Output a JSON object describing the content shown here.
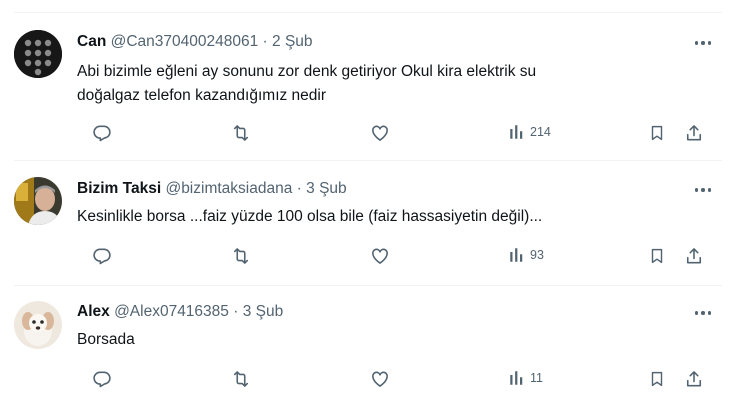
{
  "tweets": [
    {
      "name": "Can",
      "handle": "@Can370400248061",
      "dot": "·",
      "time": "2 Şub",
      "text_lines": [
        "Abi bizimle eğleni ay sonunu zor denk getiriyor Okul kira elektrik su",
        "doğalgaz telefon kazandığımız nedir"
      ],
      "views": "214"
    },
    {
      "name": "Bizim Taksi",
      "handle": "@bizimtaksiadana",
      "dot": "·",
      "time": "3 Şub",
      "text_lines": [
        "Kesinlikle borsa ...faiz yüzde 100 olsa bile (faiz hassasiyetin değil)..."
      ],
      "views": "93"
    },
    {
      "name": "Alex",
      "handle": "@Alex07416385",
      "dot": "·",
      "time": "3 Şub",
      "text_lines": [
        "Borsada"
      ],
      "views": "11"
    }
  ],
  "icons": {
    "reply": "reply-icon",
    "retweet": "retweet-icon",
    "like": "like-icon",
    "views": "views-icon",
    "bookmark": "bookmark-icon",
    "share": "share-icon",
    "more": "more-icon"
  },
  "colors": {
    "text": "#0f1419",
    "muted": "#536471",
    "divider": "#eff3f4"
  }
}
